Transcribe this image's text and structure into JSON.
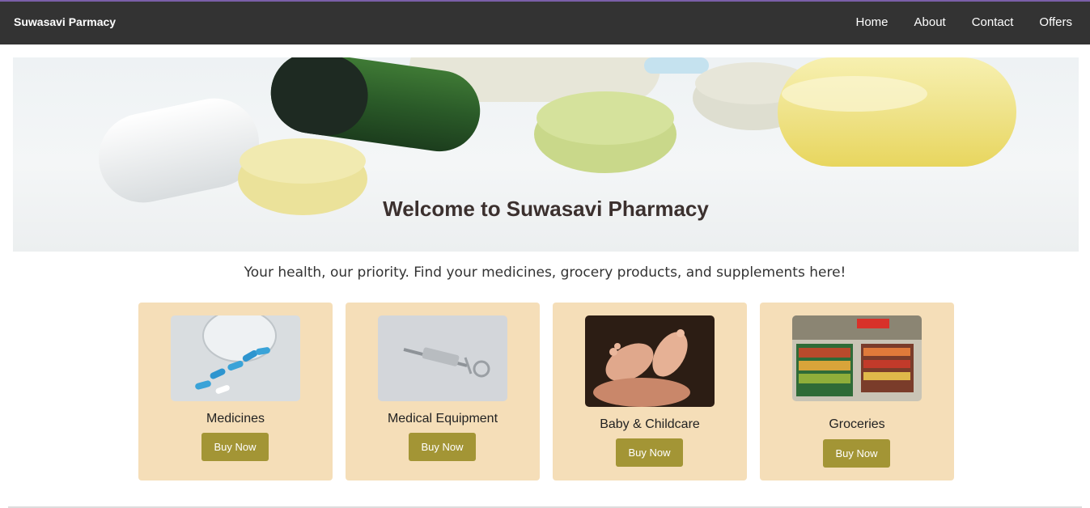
{
  "navbar": {
    "brand": "Suwasavi Parmacy",
    "links": [
      "Home",
      "About",
      "Contact",
      "Offers"
    ]
  },
  "hero": {
    "title": "Welcome to Suwasavi Pharmacy"
  },
  "tagline": "Your health, our priority. Find your medicines, grocery products, and supplements here!",
  "cards": [
    {
      "title": "Medicines",
      "button": "Buy Now"
    },
    {
      "title": "Medical Equipment",
      "button": "Buy Now"
    },
    {
      "title": "Baby & Childcare",
      "button": "Buy Now"
    },
    {
      "title": "Groceries",
      "button": "Buy Now"
    }
  ],
  "colors": {
    "navbar_bg": "#333333",
    "card_bg": "#f5deb8",
    "button_bg": "#a39535"
  }
}
